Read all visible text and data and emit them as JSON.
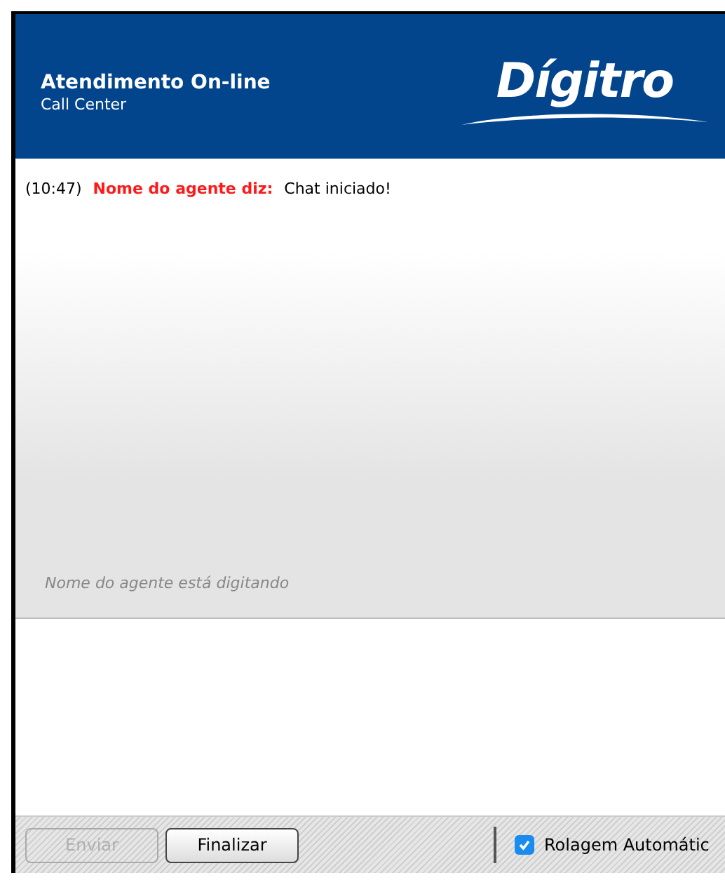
{
  "header": {
    "title": "Atendimento On-line",
    "subtitle": "Call Center",
    "logo": "Dígitro"
  },
  "messages": [
    {
      "time": "(10:47)",
      "sender": "Nome do agente diz:",
      "text": "Chat iniciado!"
    }
  ],
  "typing_status": "Nome do agente está digitando",
  "buttons": [
    {
      "label": "Enviar",
      "disabled": true
    },
    {
      "label": "Finalizar",
      "disabled": false
    }
  ],
  "auto_scroll": {
    "label": "Rolagem Automátic",
    "checked": true
  }
}
